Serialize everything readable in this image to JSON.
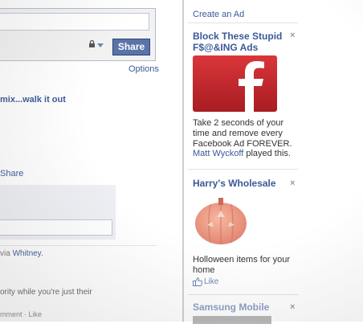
{
  "composer": {
    "share_label": "Share",
    "options_label": "Options"
  },
  "feed": {
    "post_title": "mix...walk it out",
    "share_link": "Share",
    "via_prefix": "via ",
    "via_name": "Whitney.",
    "snippet": "ority while you're just their",
    "comment_like": "mment · Like"
  },
  "sidebar": {
    "create_ad": "Create an Ad",
    "ads": [
      {
        "title_line1": "Block These Stupid",
        "title_line2": "F$@&ING Ads",
        "close": "×",
        "image_icon": "facebook-logo",
        "body": "Take 2 seconds of your time and remove every Facebook Ad FOREVER.",
        "social_name": "Matt Wyckoff",
        "social_text": " played this."
      },
      {
        "title": "Harry's Wholesale",
        "close": "×",
        "image_icon": "pumpkin-candle",
        "body": "Holloween items for your home",
        "like_label": "Like"
      },
      {
        "title": "Samsung Mobile",
        "close": "×"
      }
    ]
  },
  "colors": {
    "link": "#3b5998",
    "share_button": "#5b74a8",
    "ad_red": "#c0272d"
  }
}
